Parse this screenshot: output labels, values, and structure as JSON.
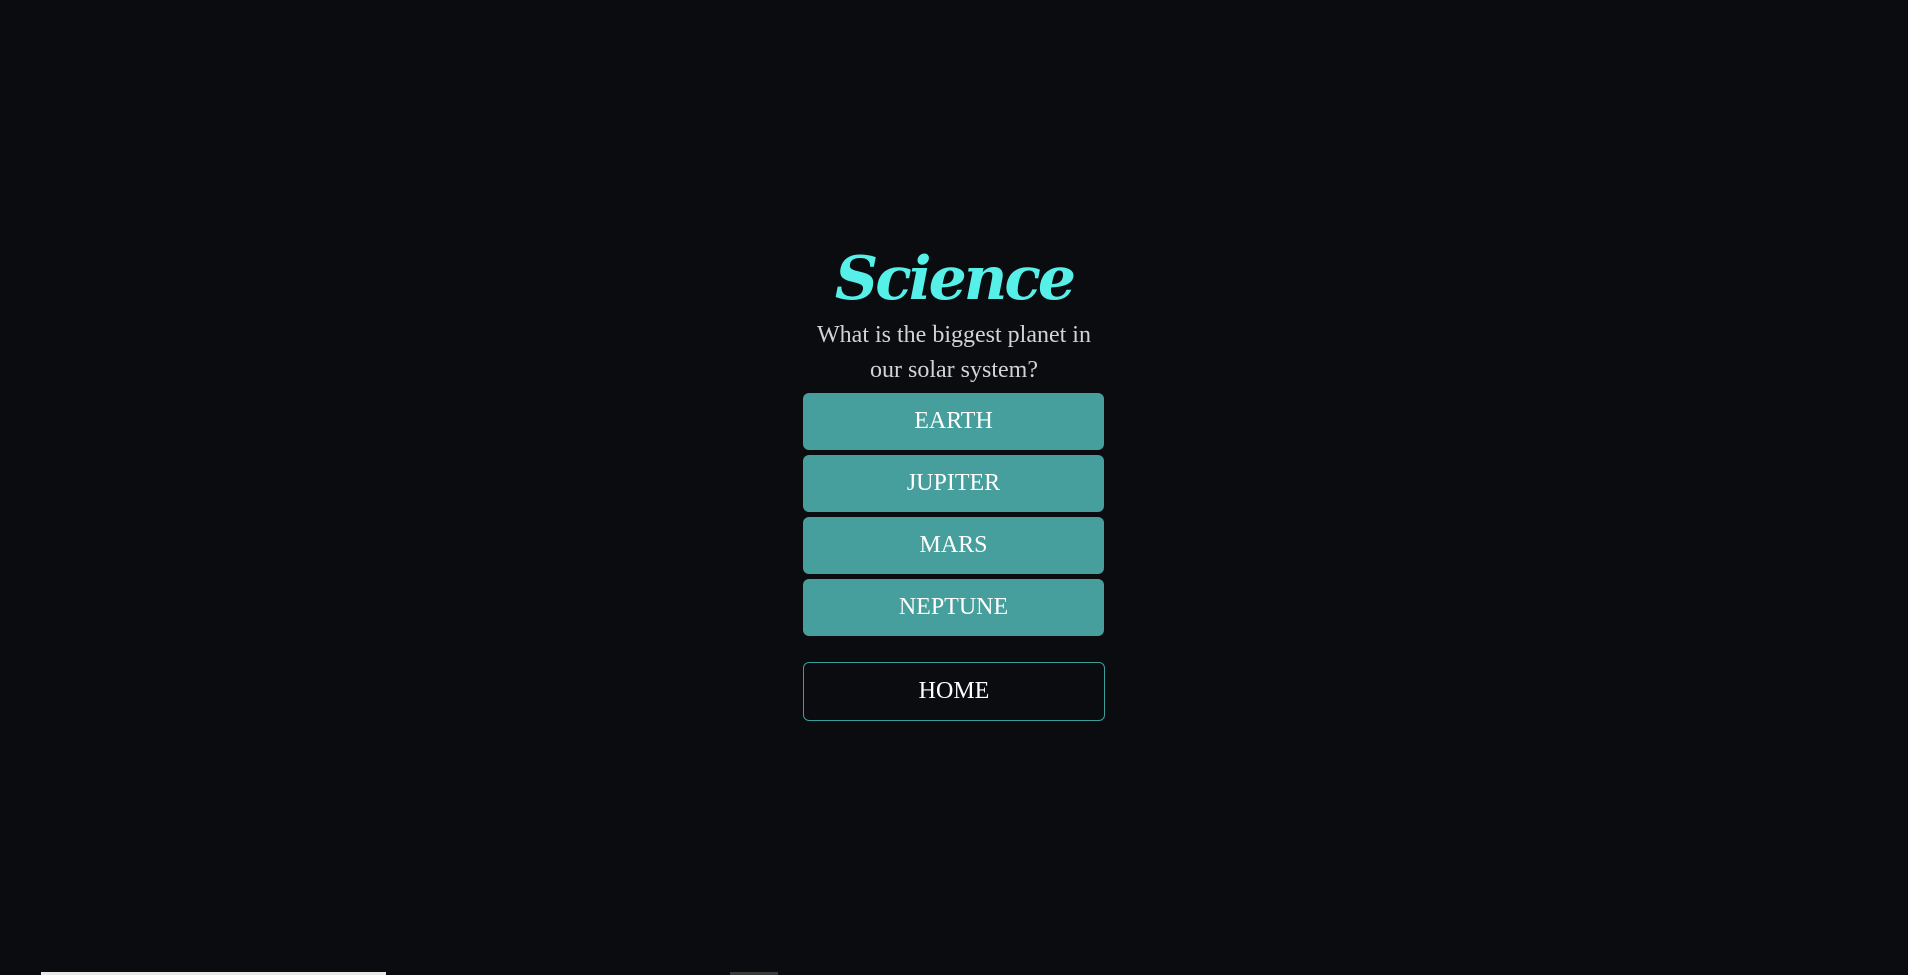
{
  "quiz": {
    "category": "Science",
    "question": "What is the biggest planet in our solar system?",
    "answers": [
      "EARTH",
      "JUPITER",
      "MARS",
      "NEPTUNE"
    ],
    "home_label": "HOME"
  },
  "colors": {
    "background": "#0a0c10",
    "title": "#56f0e8",
    "answer_button": "#469f9c",
    "home_border": "#3a9e9a"
  }
}
